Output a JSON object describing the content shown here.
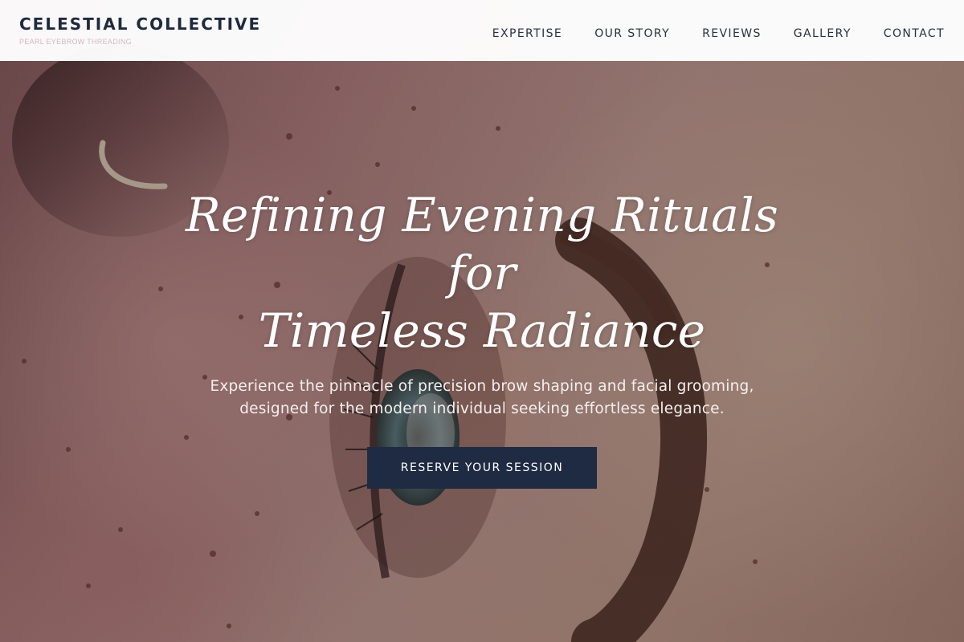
{
  "brand": {
    "name": "CELESTIAL COLLECTIVE",
    "tagline": "PEARL EYEBROW THREADING"
  },
  "nav": {
    "items": [
      {
        "label": "EXPERTISE"
      },
      {
        "label": "OUR STORY"
      },
      {
        "label": "REVIEWS"
      },
      {
        "label": "GALLERY"
      },
      {
        "label": "CONTACT"
      }
    ]
  },
  "hero": {
    "title_line1": "Refining Evening Rituals for",
    "title_line2": "Timeless Radiance",
    "subtitle": "Experience the pinnacle of precision brow shaping and facial grooming, designed for the modern individual seeking effortless elegance.",
    "cta_label": "RESERVE YOUR SESSION"
  },
  "colors": {
    "brand_navy": "#1f2b43",
    "tagline_pink": "#d7b7c4",
    "header_bg": "#ffffff"
  }
}
